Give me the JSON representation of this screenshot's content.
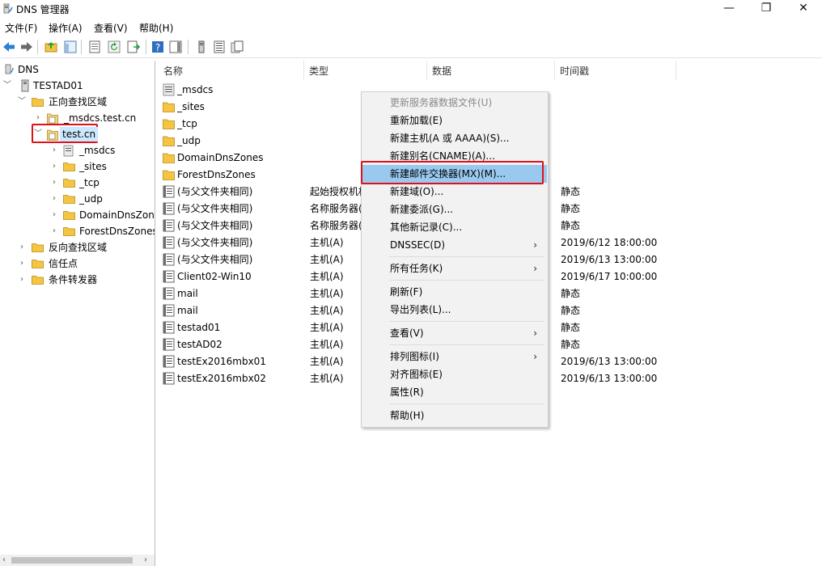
{
  "window": {
    "title": "DNS 管理器",
    "controls": {
      "minimize": "—",
      "maximize": "❐",
      "close": "✕"
    }
  },
  "menubar": [
    "文件(F)",
    "操作(A)",
    "查看(V)",
    "帮助(H)"
  ],
  "tree": {
    "root": "DNS",
    "server": "TESTAD01",
    "forward_zones": "正向查找区域",
    "msdcs_zone": "_msdcs.test.cn",
    "selected_zone": "test.cn",
    "children": [
      "_msdcs",
      "_sites",
      "_tcp",
      "_udp",
      "DomainDnsZones",
      "ForestDnsZones"
    ],
    "reverse_zones": "反向查找区域",
    "trust_points": "信任点",
    "conditional_forwarders": "条件转发器"
  },
  "columns": {
    "name": "名称",
    "type": "类型",
    "data": "数据",
    "timestamp": "时间戳"
  },
  "rows": [
    {
      "name": "_msdcs",
      "type": "",
      "data": "",
      "timestamp": "",
      "icon": "delegation-icon"
    },
    {
      "name": "_sites",
      "type": "",
      "data": "",
      "timestamp": "",
      "icon": "folder-icon"
    },
    {
      "name": "_tcp",
      "type": "",
      "data": "",
      "timestamp": "",
      "icon": "folder-icon"
    },
    {
      "name": "_udp",
      "type": "",
      "data": "",
      "timestamp": "",
      "icon": "folder-icon"
    },
    {
      "name": "DomainDnsZones",
      "type": "",
      "data": "",
      "timestamp": "",
      "icon": "folder-icon"
    },
    {
      "name": "ForestDnsZones",
      "type": "",
      "data": "",
      "timestamp": "",
      "icon": "folder-icon"
    },
    {
      "name": "(与父文件夹相同)",
      "type": "起始授权机构",
      "data": "",
      "timestamp": "静态",
      "icon": "record-icon"
    },
    {
      "name": "(与父文件夹相同)",
      "type": "名称服务器(",
      "data": "",
      "timestamp": "静态",
      "icon": "record-icon"
    },
    {
      "name": "(与父文件夹相同)",
      "type": "名称服务器(",
      "data": "",
      "timestamp": "静态",
      "icon": "record-icon"
    },
    {
      "name": "(与父文件夹相同)",
      "type": "主机(A)",
      "data": "",
      "timestamp": "2019/6/12 18:00:00",
      "icon": "record-icon"
    },
    {
      "name": "(与父文件夹相同)",
      "type": "主机(A)",
      "data": "",
      "timestamp": "2019/6/13 13:00:00",
      "icon": "record-icon"
    },
    {
      "name": "Client02-Win10",
      "type": "主机(A)",
      "data": "",
      "timestamp": "2019/6/17 10:00:00",
      "icon": "record-icon"
    },
    {
      "name": "mail",
      "type": "主机(A)",
      "data": "",
      "timestamp": "静态",
      "icon": "record-icon"
    },
    {
      "name": "mail",
      "type": "主机(A)",
      "data": "",
      "timestamp": "静态",
      "icon": "record-icon"
    },
    {
      "name": "testad01",
      "type": "主机(A)",
      "data": "",
      "timestamp": "静态",
      "icon": "record-icon"
    },
    {
      "name": "testAD02",
      "type": "主机(A)",
      "data": "",
      "timestamp": "静态",
      "icon": "record-icon"
    },
    {
      "name": "testEx2016mbx01",
      "type": "主机(A)",
      "data": "",
      "timestamp": "2019/6/13 13:00:00",
      "icon": "record-icon"
    },
    {
      "name": "testEx2016mbx02",
      "type": "主机(A)",
      "data": "",
      "timestamp": "2019/6/13 13:00:00",
      "icon": "record-icon"
    }
  ],
  "context_menu": {
    "update_server_data": "更新服务器数据文件(U)",
    "reload": "重新加载(E)",
    "new_host": "新建主机(A 或 AAAA)(S)...",
    "new_alias": "新建别名(CNAME)(A)...",
    "new_mx": "新建邮件交换器(MX)(M)...",
    "new_domain": "新建域(O)...",
    "new_delegation": "新建委派(G)...",
    "other_records": "其他新记录(C)...",
    "dnssec": "DNSSEC(D)",
    "all_tasks": "所有任务(K)",
    "refresh": "刷新(F)",
    "export_list": "导出列表(L)...",
    "view": "查看(V)",
    "arrange_icons": "排列图标(I)",
    "line_up_icons": "对齐图标(E)",
    "properties": "属性(R)",
    "help": "帮助(H)",
    "submenu_arrow": "›"
  },
  "colors": {
    "highlight_bg": "#99c9ef",
    "annotation_red": "#e0101a",
    "menu_bg": "#f2f2f2",
    "folder": "#f5c542"
  }
}
